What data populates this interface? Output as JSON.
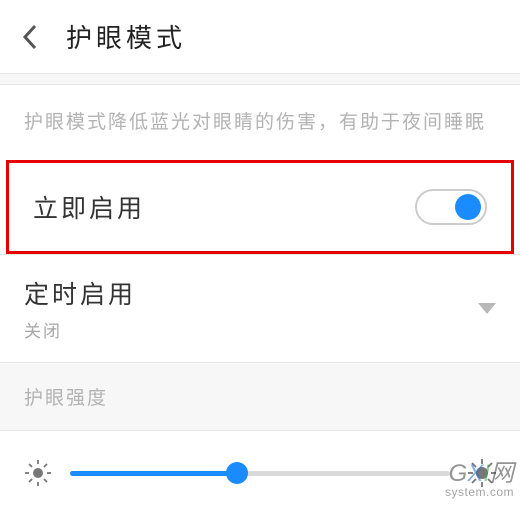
{
  "header": {
    "title": "护眼模式"
  },
  "description": "护眼模式降低蓝光对眼睛的伤害，有助于夜间睡眠",
  "enable_now": {
    "label": "立即启用",
    "on": true
  },
  "scheduled": {
    "label": "定时启用",
    "status": "关闭"
  },
  "intensity": {
    "section_label": "护眼强度",
    "value_percent": 44
  },
  "watermark": {
    "brand_g": "G",
    "brand_x": "X",
    "brand_i": "I",
    "brand_suffix": "网",
    "domain": "system.com"
  },
  "colors": {
    "accent": "#1a8cff",
    "highlight": "#e60000"
  }
}
